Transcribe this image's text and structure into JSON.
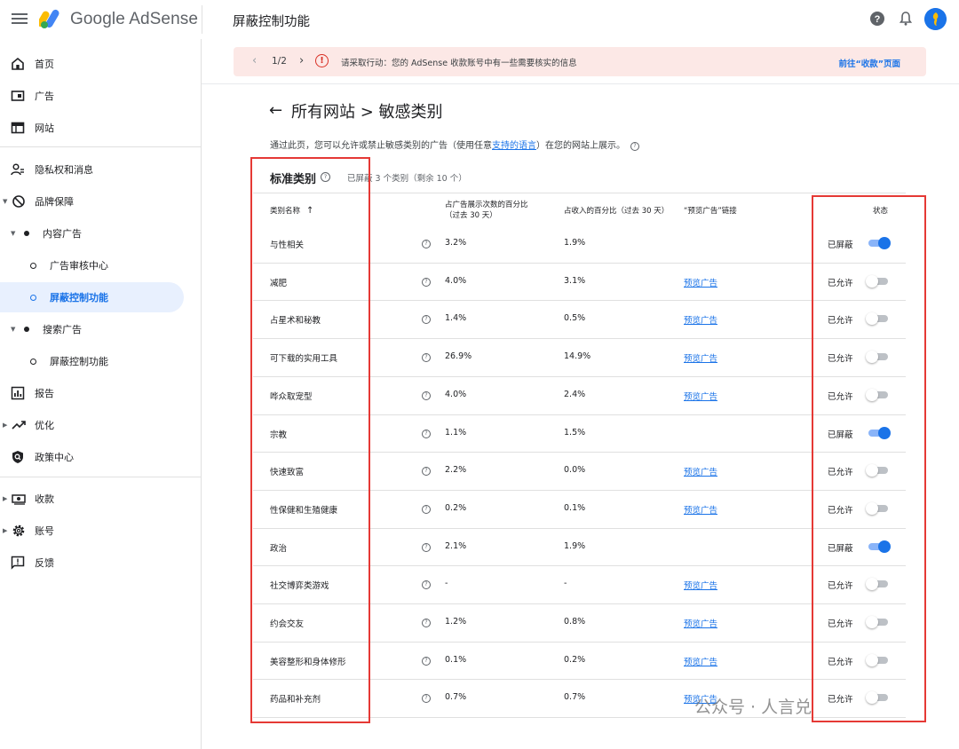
{
  "app": {
    "name": "Google AdSense",
    "page_title": "屏蔽控制功能"
  },
  "topbar": {
    "menu_icon": "menu-icon",
    "help_icon": "help-icon",
    "bell_icon": "notifications-icon",
    "avatar_icon": "avatar"
  },
  "sidebar": {
    "items": [
      {
        "label": "首页",
        "icon": "home-icon"
      },
      {
        "label": "广告",
        "icon": "ads-icon"
      },
      {
        "label": "网站",
        "icon": "sites-icon"
      },
      {
        "label": "隐私权和消息",
        "icon": "privacy-icon"
      },
      {
        "label": "品牌保障",
        "icon": "block-icon"
      },
      {
        "label": "内容广告"
      },
      {
        "label": "广告审核中心"
      },
      {
        "label": "屏蔽控制功能",
        "active": true
      },
      {
        "label": "搜索广告"
      },
      {
        "label": "屏蔽控制功能"
      },
      {
        "label": "报告",
        "icon": "report-icon"
      },
      {
        "label": "优化",
        "icon": "trend-icon"
      },
      {
        "label": "政策中心",
        "icon": "policy-icon"
      },
      {
        "label": "收款",
        "icon": "payments-icon"
      },
      {
        "label": "账号",
        "icon": "settings-icon"
      },
      {
        "label": "反馈",
        "icon": "feedback-icon"
      }
    ]
  },
  "alert": {
    "pager": "1/2",
    "message": "请采取行动：您的 AdSense 收款账号中有一些需要核实的信息",
    "action": "前往“收款”页面"
  },
  "main": {
    "title": "所有网站 > 敏感类别",
    "intro_before": "通过此页，您可以允许或禁止敏感类别的广告（使用任意",
    "intro_link": "支持的语言",
    "intro_after": "）在您的网站上展示。",
    "section_title": "标准类别",
    "section_summary": "已屏蔽 3 个类别（剩余 10 个）"
  },
  "table": {
    "headers": {
      "name": "类别名称",
      "sort_arrow": "↑",
      "impressions_1": "占广告展示次数的百分比",
      "impressions_2": "（过去 30 天）",
      "revenue": "占收入的百分比（过去 30 天）",
      "preview": "“预览广告”链接",
      "status": "状态"
    },
    "rows": [
      {
        "name": "与性相关",
        "impressions": "3.2%",
        "revenue": "1.9%",
        "preview": "",
        "status": "已屏蔽",
        "on": true
      },
      {
        "name": "减肥",
        "impressions": "4.0%",
        "revenue": "3.1%",
        "preview": "预览广告",
        "status": "已允许",
        "on": false
      },
      {
        "name": "占星术和秘教",
        "impressions": "1.4%",
        "revenue": "0.5%",
        "preview": "预览广告",
        "status": "已允许",
        "on": false
      },
      {
        "name": "可下载的实用工具",
        "impressions": "26.9%",
        "revenue": "14.9%",
        "preview": "预览广告",
        "status": "已允许",
        "on": false
      },
      {
        "name": "哗众取宠型",
        "impressions": "4.0%",
        "revenue": "2.4%",
        "preview": "预览广告",
        "status": "已允许",
        "on": false
      },
      {
        "name": "宗教",
        "impressions": "1.1%",
        "revenue": "1.5%",
        "preview": "",
        "status": "已屏蔽",
        "on": true
      },
      {
        "name": "快速致富",
        "impressions": "2.2%",
        "revenue": "0.0%",
        "preview": "预览广告",
        "status": "已允许",
        "on": false
      },
      {
        "name": "性保健和生殖健康",
        "impressions": "0.2%",
        "revenue": "0.1%",
        "preview": "预览广告",
        "status": "已允许",
        "on": false
      },
      {
        "name": "政治",
        "impressions": "2.1%",
        "revenue": "1.9%",
        "preview": "",
        "status": "已屏蔽",
        "on": true
      },
      {
        "name": "社交博弈类游戏",
        "impressions": "-",
        "revenue": "-",
        "preview": "预览广告",
        "status": "已允许",
        "on": false
      },
      {
        "name": "约会交友",
        "impressions": "1.2%",
        "revenue": "0.8%",
        "preview": "预览广告",
        "status": "已允许",
        "on": false
      },
      {
        "name": "美容整形和身体修形",
        "impressions": "0.1%",
        "revenue": "0.2%",
        "preview": "预览广告",
        "status": "已允许",
        "on": false
      },
      {
        "name": "药品和补充剂",
        "impressions": "0.7%",
        "revenue": "0.7%",
        "preview": "预览广告",
        "status": "已允许",
        "on": false
      }
    ]
  },
  "watermark": "公众号 · 人言兑",
  "colors": {
    "accent": "#1a73e8",
    "alert_bg": "#fce8e6",
    "highlight": "#e53935"
  }
}
